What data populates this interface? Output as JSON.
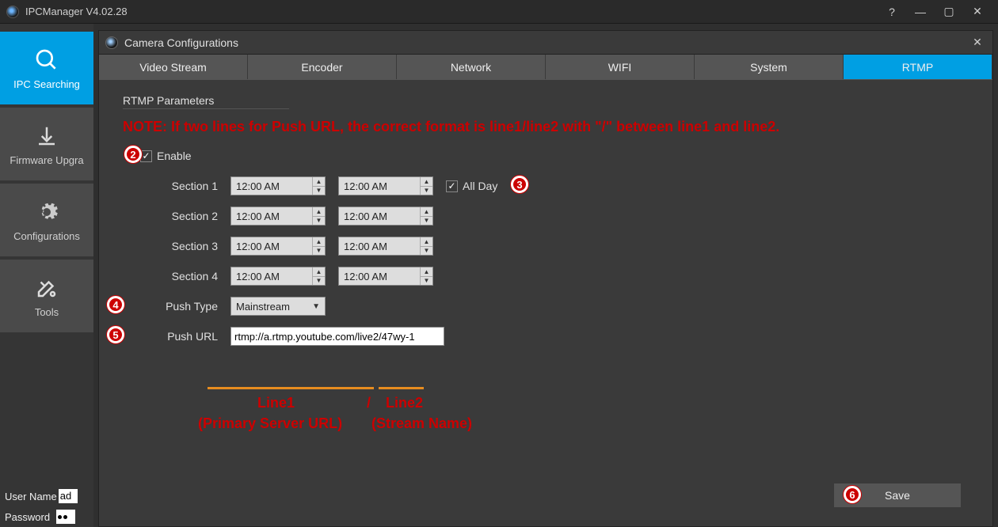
{
  "app": {
    "title": "IPCManager V4.02.28"
  },
  "winbtns": {
    "help": "?",
    "min": "—",
    "max": "▢",
    "close": "✕"
  },
  "sidebar": {
    "items": [
      {
        "key": "ipc-search",
        "label": "IPC Searching",
        "active": true
      },
      {
        "key": "fw-upgrade",
        "label": "Firmware Upgra",
        "active": false
      },
      {
        "key": "config",
        "label": "Configurations",
        "active": false
      },
      {
        "key": "tools",
        "label": "Tools",
        "active": false
      }
    ],
    "user_name_label": "User Name",
    "user_name_value": "ad",
    "password_label": "Password"
  },
  "panel": {
    "title": "Camera Configurations",
    "close": "✕",
    "tabs": [
      "Video Stream",
      "Encoder",
      "Network",
      "WIFI",
      "System",
      "RTMP"
    ],
    "active_tab": 5,
    "section_title": "RTMP Parameters",
    "note": "NOTE: If two lines for Push URL, the correct format is line1/line2 with \"/\" between line1 and line2.",
    "enable": {
      "label": "Enable",
      "checked": true
    },
    "sections": [
      {
        "label": "Section 1",
        "from": "12:00 AM",
        "to": "12:00 AM",
        "allday": {
          "label": "All Day",
          "checked": true
        }
      },
      {
        "label": "Section 2",
        "from": "12:00 AM",
        "to": "12:00 AM"
      },
      {
        "label": "Section 3",
        "from": "12:00 AM",
        "to": "12:00 AM"
      },
      {
        "label": "Section 4",
        "from": "12:00 AM",
        "to": "12:00 AM"
      }
    ],
    "push_type": {
      "label": "Push Type",
      "value": "Mainstream"
    },
    "push_url": {
      "label": "Push URL",
      "value": "rtmp://a.rtmp.youtube.com/live2/47wy-1"
    },
    "save_label": "Save",
    "annotations": {
      "line1": "Line1",
      "line2": "Line2",
      "primary": "(Primary Server URL)",
      "stream": "(Stream Name)",
      "slash": "/"
    }
  }
}
